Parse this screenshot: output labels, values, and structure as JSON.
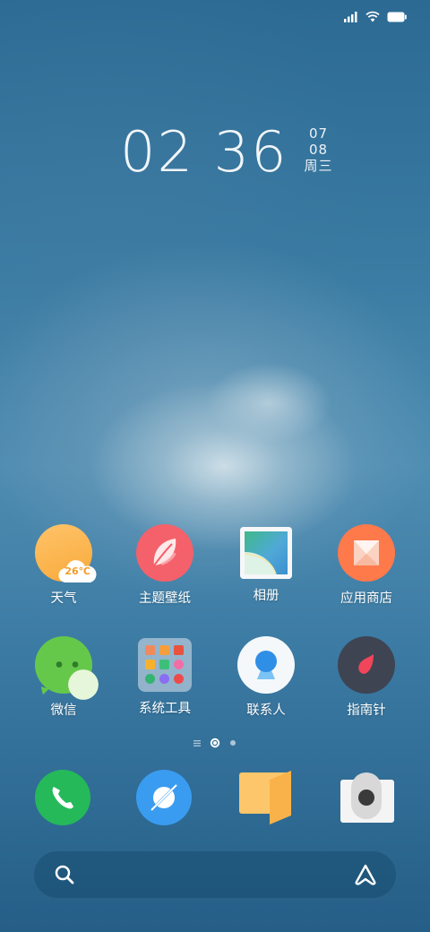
{
  "status_bar": {
    "icons": [
      "signal-icon",
      "wifi-icon",
      "battery-icon"
    ]
  },
  "clock": {
    "hour": "02",
    "minute": "36",
    "month": "07",
    "day": "08",
    "weekday": "周三"
  },
  "apps": [
    {
      "label": "天气",
      "icon": "weather-icon",
      "temp": "26℃"
    },
    {
      "label": "主题壁纸",
      "icon": "theme-icon"
    },
    {
      "label": "相册",
      "icon": "gallery-icon"
    },
    {
      "label": "应用商店",
      "icon": "app-store-icon"
    },
    {
      "label": "微信",
      "icon": "wechat-icon"
    },
    {
      "label": "系统工具",
      "icon": "system-tools-folder-icon"
    },
    {
      "label": "联系人",
      "icon": "contacts-icon"
    },
    {
      "label": "指南针",
      "icon": "compass-icon"
    }
  ],
  "page_indicator": {
    "pages": 2,
    "current": 1
  },
  "dock": [
    {
      "icon": "phone-icon"
    },
    {
      "icon": "browser-icon"
    },
    {
      "icon": "notes-icon"
    },
    {
      "icon": "camera-icon"
    }
  ],
  "search_bar": {
    "icons": [
      "search-icon",
      "assistant-icon"
    ]
  }
}
